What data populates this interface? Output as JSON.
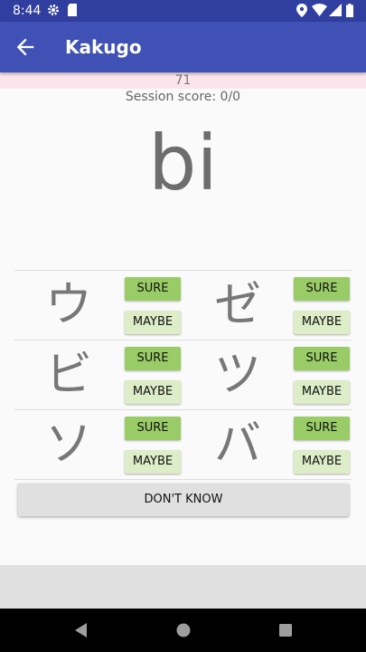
{
  "status_bar": {
    "time": "8:44"
  },
  "app_bar": {
    "title": "Kakugo"
  },
  "counter": "71",
  "session_score": "Session score: 0/0",
  "question": "bi",
  "answers": [
    {
      "kana": "ウ",
      "sure": "SURE",
      "maybe": "MAYBE"
    },
    {
      "kana": "ゼ",
      "sure": "SURE",
      "maybe": "MAYBE"
    },
    {
      "kana": "ビ",
      "sure": "SURE",
      "maybe": "MAYBE"
    },
    {
      "kana": "ツ",
      "sure": "SURE",
      "maybe": "MAYBE"
    },
    {
      "kana": "ソ",
      "sure": "SURE",
      "maybe": "MAYBE"
    },
    {
      "kana": "バ",
      "sure": "SURE",
      "maybe": "MAYBE"
    }
  ],
  "dont_know": "DON'T KNOW",
  "colors": {
    "primary": "#3f51b5",
    "primary_dark": "#303f9f",
    "sure": "#99cc66",
    "maybe": "#dcedc8"
  }
}
